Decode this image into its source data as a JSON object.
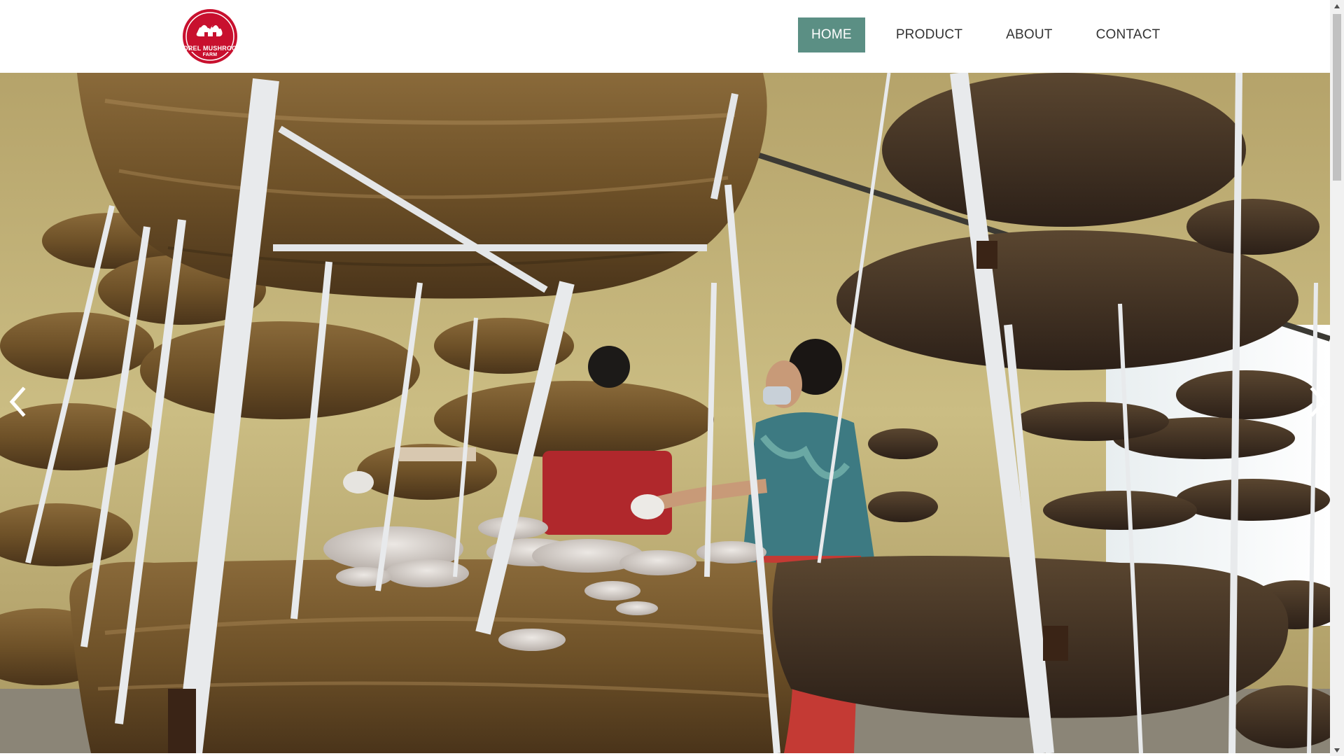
{
  "site": {
    "logo": {
      "name": "logo-icon",
      "line1": "MOREL MUSHROOM",
      "line2": "FARM",
      "color": "#c8102e"
    }
  },
  "nav": {
    "accent": "#5b8f84",
    "items": [
      {
        "label": "HOME",
        "active": true
      },
      {
        "label": "PRODUCT",
        "active": false
      },
      {
        "label": "ABOUT",
        "active": false
      },
      {
        "label": "CONTACT",
        "active": false
      }
    ]
  },
  "carousel": {
    "image": "mushroom-farm-photo",
    "prev_icon": "chevron-left-icon",
    "next_icon": "chevron-right-icon"
  },
  "scrollbar": {
    "up_icon": "scroll-up-arrow-icon",
    "down_icon": "scroll-down-arrow-icon"
  }
}
